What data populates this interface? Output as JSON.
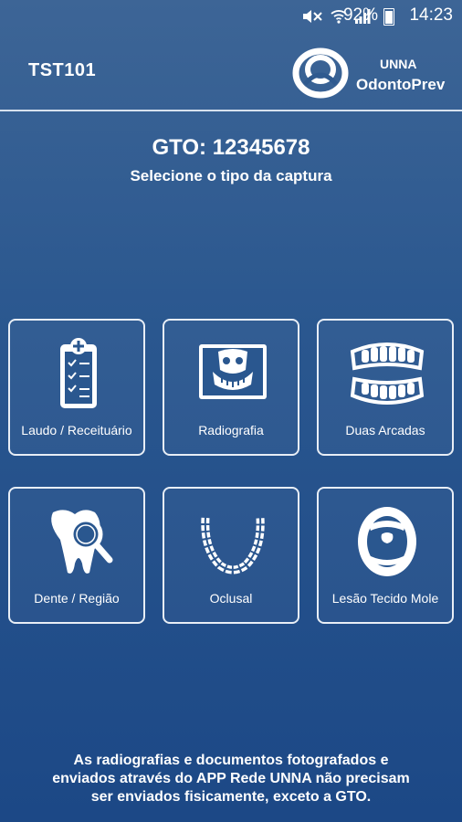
{
  "status_bar": {
    "battery": "92%",
    "time": "14:23",
    "icons": [
      "mute-icon",
      "wifi-icon",
      "signal-icon",
      "battery-icon"
    ]
  },
  "header": {
    "title": "TST101",
    "logo": {
      "line1": "UNNA",
      "line2": "OdontoPrev"
    }
  },
  "main": {
    "gto": "GTO: 12345678",
    "subtitle": "Selecione o tipo da captura"
  },
  "tiles": [
    {
      "label": "Laudo / Receituário",
      "icon": "clipboard-icon"
    },
    {
      "label": "Radiografia",
      "icon": "radiograph-icon"
    },
    {
      "label": "Duas Arcadas",
      "icon": "teeth-arches-icon"
    },
    {
      "label": "Dente / Região",
      "icon": "tooth-magnifier-icon"
    },
    {
      "label": "Oclusal",
      "icon": "occlusal-arch-icon"
    },
    {
      "label": "Lesão Tecido Mole",
      "icon": "open-mouth-icon"
    }
  ],
  "footer": {
    "line1": "As radiografias e documentos fotografados e",
    "line2": "enviados através do APP Rede UNNA não precisam",
    "line3": "ser enviados fisicamente, exceto a GTO."
  },
  "colors": {
    "background_top": "#3d6596",
    "background_bottom": "#1c4886",
    "tile_border": "#e8eef6"
  }
}
